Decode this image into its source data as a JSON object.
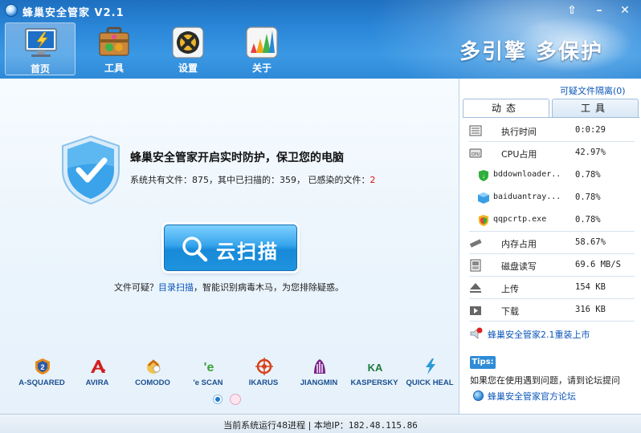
{
  "app": {
    "title": "蜂巢安全管家 V2.1"
  },
  "window_controls": {
    "pin": "⇧",
    "minimize": "–",
    "close": "✕"
  },
  "nav": [
    {
      "label": "首页",
      "icon": "monitor-lightning-icon",
      "active": true
    },
    {
      "label": "工具",
      "icon": "toolbox-icon",
      "active": false
    },
    {
      "label": "设置",
      "icon": "gear-settings-icon",
      "active": false
    },
    {
      "label": "关于",
      "icon": "about-chart-icon",
      "active": false
    }
  ],
  "slogan": "多引擎  多保护",
  "main": {
    "headline": "蜂巢安全管家开启实时防护，保卫您的电脑",
    "stats_prefix": "系统共有文件：875，其中已扫描的：359， 已感染的文件：",
    "infected": "2",
    "scan_button": "云扫描",
    "hint_prefix": "文件可疑？",
    "hint_link": "目录扫描",
    "hint_suffix": "，智能识别病毒木马，为您排除疑惑。"
  },
  "engines": [
    {
      "name": "A-SQUARED",
      "color": "#e88a1a"
    },
    {
      "name": "AVIRA",
      "color": "#d22020"
    },
    {
      "name": "COMODO",
      "color": "#e5a21a"
    },
    {
      "name": "'e SCAN",
      "color": "#3aa33a"
    },
    {
      "name": "IKARUS",
      "color": "#d8411a"
    },
    {
      "name": "JIANGMIN",
      "color": "#7a1f8a"
    },
    {
      "name": "KASPERSKY",
      "color": "#1c7a3a"
    },
    {
      "name": "QUICK HEAL",
      "color": "#2a9ad8"
    }
  ],
  "side": {
    "quarantine": "可疑文件隔离(0)",
    "tab_dynamic": "动态",
    "tab_tools": "工具",
    "rows": [
      {
        "label": "执行时间",
        "value": "0:0:29",
        "icon": "clock-list-icon"
      },
      {
        "label": "CPU占用",
        "value": "42.97%",
        "icon": "cpu-icon"
      },
      {
        "label": "bddownloader..",
        "value": "0.78%",
        "icon": "green-shield-icon"
      },
      {
        "label": "baiduantray...",
        "value": "0.78%",
        "icon": "blue-cube-icon"
      },
      {
        "label": "qqpcrtp.exe",
        "value": "0.78%",
        "icon": "qq-shield-icon"
      },
      {
        "label": "内存占用",
        "value": "58.67%",
        "icon": "memory-icon"
      },
      {
        "label": "磁盘读写",
        "value": "69.6 MB/S",
        "icon": "disk-icon"
      },
      {
        "label": "上传",
        "value": "154 KB",
        "icon": "upload-icon"
      },
      {
        "label": "下载",
        "value": "316 KB",
        "icon": "download-icon"
      }
    ],
    "news": "蜂巢安全管家2.1重装上市",
    "tips_badge": "Tips:",
    "tips_text": "如果您在使用遇到问题，请到论坛提问",
    "forum_link": "蜂巢安全管家官方论坛"
  },
  "status": {
    "prefix": "当前系统运行48进程  |  本地IP：",
    "ip": "182.48.115.86"
  },
  "colors": {
    "accent": "#2a86d8",
    "link": "#0b55b8",
    "infected": "#e01010"
  }
}
